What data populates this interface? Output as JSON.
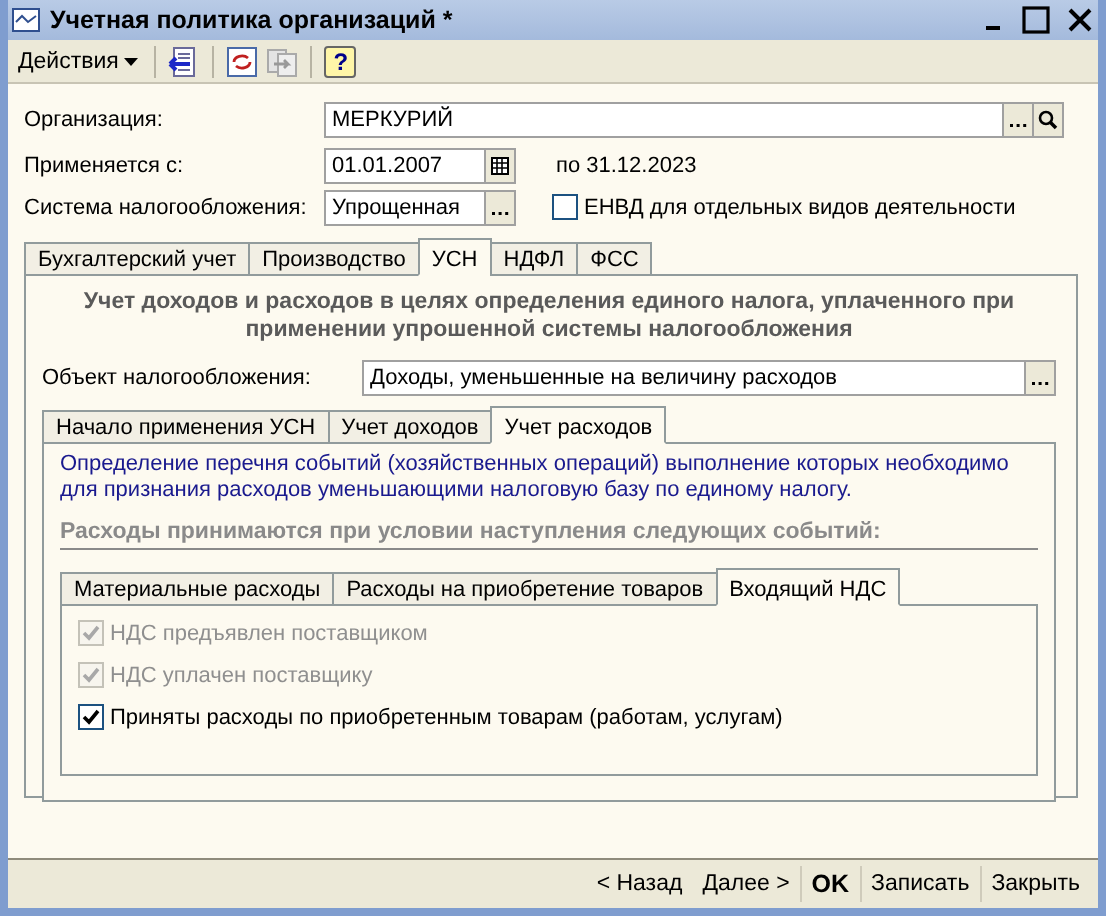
{
  "window": {
    "title": "Учетная политика организаций *"
  },
  "toolbar": {
    "actions": "Действия",
    "help": "?"
  },
  "form": {
    "organization": {
      "label": "Организация:",
      "value": "МЕРКУРИЙ"
    },
    "applies_from": {
      "label": "Применяется с:",
      "value": "01.01.2007",
      "until": "по 31.12.2023"
    },
    "tax_system": {
      "label": "Система налогообложения:",
      "value": "Упрощенная"
    },
    "envd": {
      "label": "ЕНВД для отдельных видов деятельности",
      "checked": false
    }
  },
  "tabs": [
    {
      "label": "Бухгалтерский учет",
      "selected": false
    },
    {
      "label": "Производство",
      "selected": false
    },
    {
      "label": "УСН",
      "selected": true
    },
    {
      "label": "НДФЛ",
      "selected": false
    },
    {
      "label": "ФСС",
      "selected": false
    }
  ],
  "usn": {
    "heading": "Учет доходов и расходов в целях определения единого налога, уплаченного при применении упрошенной системы налогообложения",
    "object": {
      "label": "Объект налогообложения:",
      "value": "Доходы, уменьшенные на величину расходов"
    },
    "tabs": [
      {
        "label": "Начало применения УСН",
        "selected": false
      },
      {
        "label": "Учет доходов",
        "selected": false
      },
      {
        "label": "Учет расходов",
        "selected": true
      }
    ],
    "description": "Определение перечня событий (хозяйственных операций) выполнение которых необходимо для признания расходов уменьшающими налоговую базу по единому налогу.",
    "section_title": "Расходы принимаются при условии наступления следующих событий:",
    "expense_tabs": [
      {
        "label": "Материальные расходы",
        "selected": false
      },
      {
        "label": "Расходы на приобретение товаров",
        "selected": false
      },
      {
        "label": "Входящий НДС",
        "selected": true
      }
    ],
    "checks": [
      {
        "label": "НДС предъявлен поставщиком",
        "checked": true,
        "disabled": true
      },
      {
        "label": "НДС уплачен поставщику",
        "checked": true,
        "disabled": true
      },
      {
        "label": "Приняты расходы по приобретенным товарам (работам, услугам)",
        "checked": true,
        "disabled": false
      }
    ]
  },
  "buttons": {
    "back": "< Назад",
    "next": "Далее >",
    "ok": "OK",
    "save": "Записать",
    "close": "Закрыть"
  }
}
